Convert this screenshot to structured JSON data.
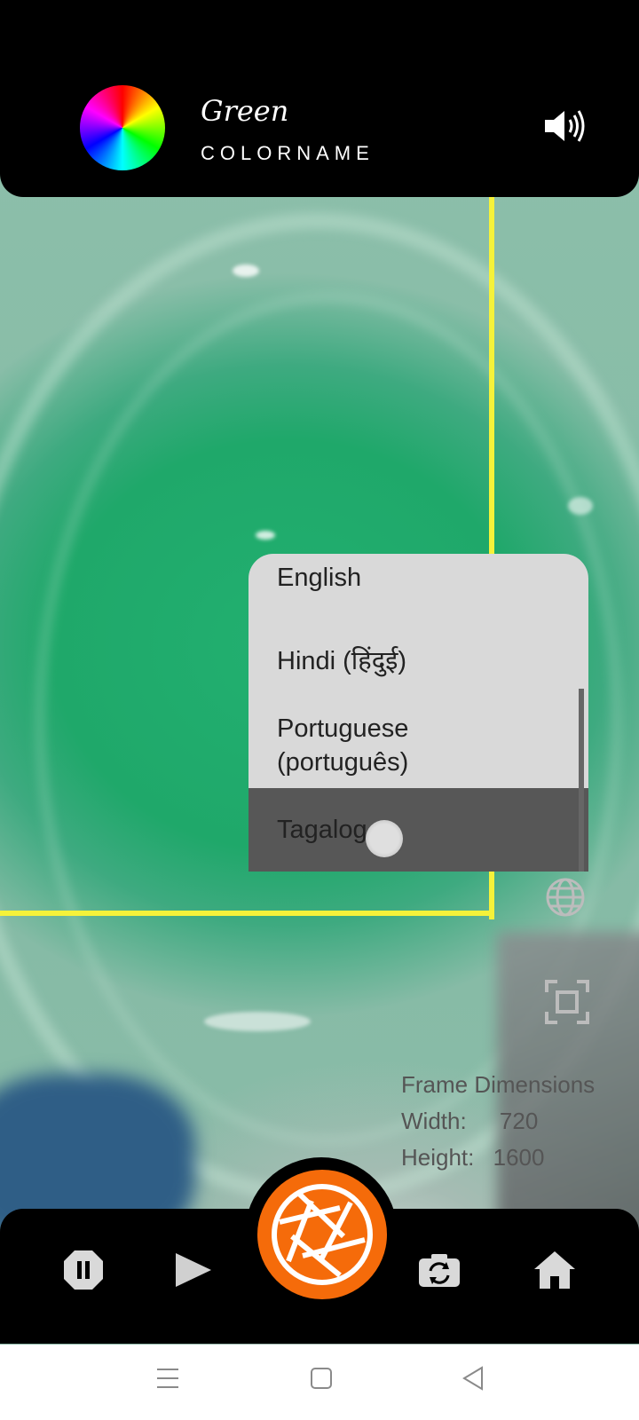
{
  "header": {
    "color_name": "Green",
    "subtitle": "COLORNAME"
  },
  "language_menu": {
    "items": [
      "English",
      "Hindi (हिंदुई)",
      "Portuguese",
      "(português)",
      "Tagalog"
    ],
    "selected": "Tagalog"
  },
  "frame_info": {
    "title": "Frame Dimensions",
    "width_label": "Width:",
    "width_value": "720",
    "height_label": "Height:",
    "height_value": "1600"
  },
  "icons": {
    "color_wheel": "color-wheel-icon",
    "speaker": "speaker-icon",
    "globe": "globe-icon",
    "fullscreen": "fullscreen-icon",
    "pause": "pause-icon",
    "play": "play-icon",
    "shutter": "camera-shutter-icon",
    "switch_camera": "switch-camera-icon",
    "home": "home-icon"
  },
  "colors": {
    "accent": "#f56b0a",
    "frame": "#f5f23a",
    "detected": "#22b070"
  }
}
